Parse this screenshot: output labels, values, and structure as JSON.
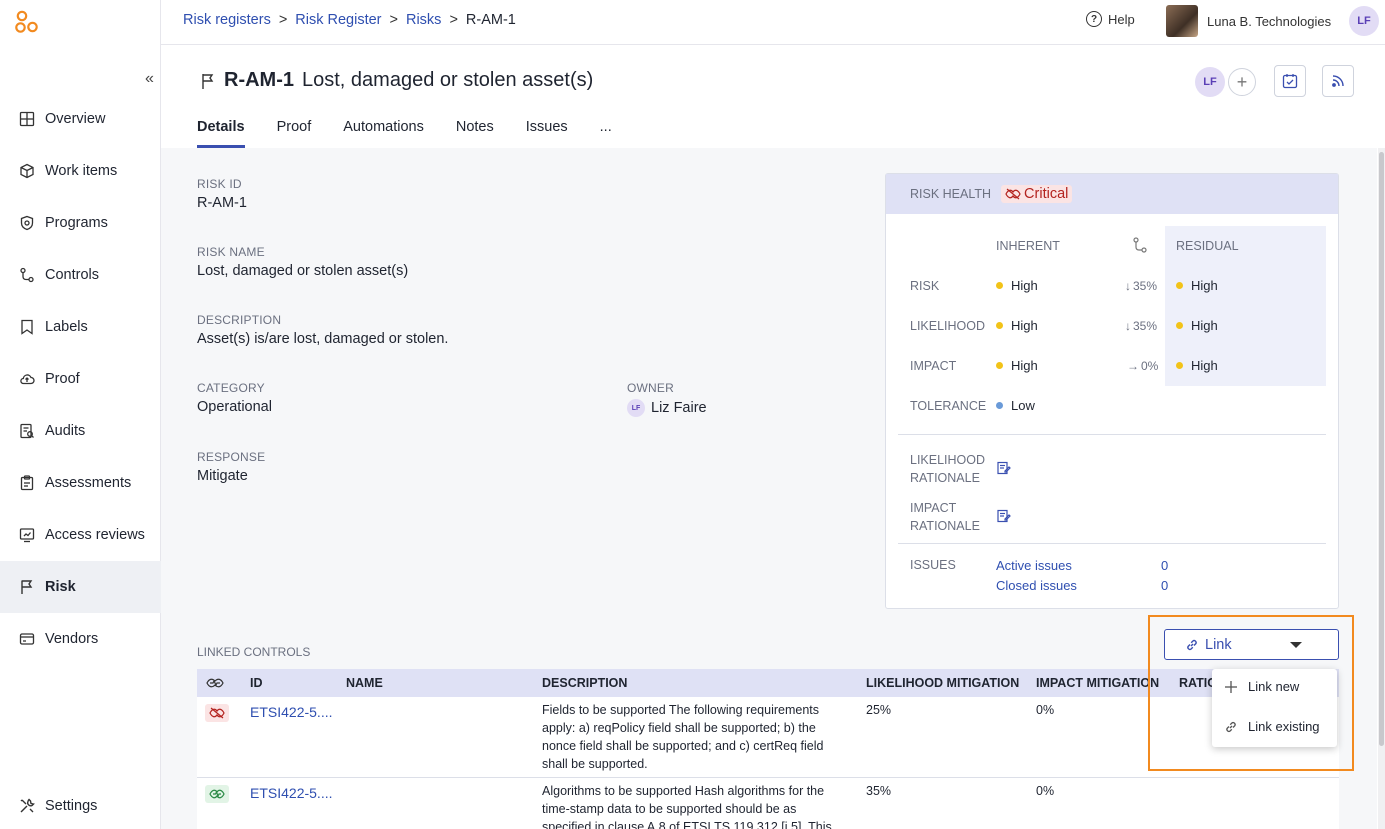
{
  "sidebar": {
    "items": [
      {
        "label": "Overview",
        "icon": "layout-icon"
      },
      {
        "label": "Work items",
        "icon": "box-icon"
      },
      {
        "label": "Programs",
        "icon": "shield-icon"
      },
      {
        "label": "Controls",
        "icon": "controls-icon"
      },
      {
        "label": "Labels",
        "icon": "label-icon"
      },
      {
        "label": "Proof",
        "icon": "cloud-icon"
      },
      {
        "label": "Audits",
        "icon": "audit-icon"
      },
      {
        "label": "Assessments",
        "icon": "clipboard-icon"
      },
      {
        "label": "Access reviews",
        "icon": "access-icon"
      },
      {
        "label": "Risk",
        "icon": "flag-icon"
      },
      {
        "label": "Vendors",
        "icon": "vendor-icon"
      }
    ],
    "settings_label": "Settings",
    "collapse_glyph": "«"
  },
  "topbar": {
    "breadcrumb": [
      "Risk registers",
      "Risk Register",
      "Risks",
      "R-AM-1"
    ],
    "separator": ">",
    "help_label": "Help",
    "help_glyph": "?",
    "org_name": "Luna B. Technologies",
    "user_initials": "LF"
  },
  "header": {
    "risk_id": "R-AM-1",
    "risk_title": "Lost, damaged or stolen asset(s)",
    "avatar_initials": "LF",
    "add_glyph": "+",
    "tabs": [
      "Details",
      "Proof",
      "Automations",
      "Notes",
      "Issues",
      "..."
    ]
  },
  "details": {
    "risk_id_label": "RISK ID",
    "risk_id": "R-AM-1",
    "risk_name_label": "RISK NAME",
    "risk_name": "Lost, damaged or stolen asset(s)",
    "description_label": "DESCRIPTION",
    "description": "Asset(s) is/are lost, damaged or stolen.",
    "category_label": "CATEGORY",
    "category": "Operational",
    "owner_label": "OWNER",
    "owner": "Liz Faire",
    "owner_initials": "LF",
    "response_label": "RESPONSE",
    "response": "Mitigate"
  },
  "risk_health": {
    "label": "RISK HEALTH",
    "status": "Critical",
    "inherent_label": "INHERENT",
    "residual_label": "RESIDUAL",
    "rows": [
      {
        "label": "RISK",
        "inherent": "High",
        "change": "35%",
        "arrow": "↓",
        "residual": "High"
      },
      {
        "label": "LIKELIHOOD",
        "inherent": "High",
        "change": "35%",
        "arrow": "↓",
        "residual": "High"
      },
      {
        "label": "IMPACT",
        "inherent": "High",
        "change": "0%",
        "arrow": "→",
        "residual": "High"
      }
    ],
    "tolerance_label": "TOLERANCE",
    "tolerance": "Low",
    "likelihood_rationale_label": [
      "LIKELIHOOD",
      "RATIONALE"
    ],
    "impact_rationale_label": [
      "IMPACT",
      "RATIONALE"
    ],
    "issues_label": "ISSUES",
    "active_issues_label": "Active issues",
    "active_issues": "0",
    "closed_issues_label": "Closed issues",
    "closed_issues": "0"
  },
  "linked_controls": {
    "label": "LINKED CONTROLS",
    "columns": [
      "ID",
      "NAME",
      "DESCRIPTION",
      "LIKELIHOOD MITIGATION",
      "IMPACT MITIGATION",
      "RATIO"
    ],
    "rows": [
      {
        "status": "unhealthy",
        "id": "ETSI422-5....",
        "name": "",
        "description": [
          "Fields to be supported The following requirements",
          "apply: a) reqPolicy field shall be supported; b) the",
          "nonce field shall be supported; and c) certReq field",
          "shall be supported."
        ],
        "likelihood": "25%",
        "impact": "0%"
      },
      {
        "status": "healthy",
        "id": "ETSI422-5....",
        "name": "",
        "description": [
          "Algorithms to be supported Hash algorithms for the",
          "time-stamp data to be supported should be as",
          "specified in clause A.8 of ETSI TS 119 312 [i.5]. This"
        ],
        "likelihood": "35%",
        "impact": "0%"
      }
    ],
    "link_button_label": "Link",
    "menu": [
      {
        "label": "Link new",
        "icon": "plus-icon"
      },
      {
        "label": "Link existing",
        "icon": "link-icon"
      }
    ]
  },
  "colors": {
    "accent": "#3a4fb0",
    "link": "#2f4fb0",
    "critical": "#b3231f",
    "high_dot": "#f2c318",
    "low_dot": "#6a9ad8",
    "highlight": "#f28a1f"
  }
}
